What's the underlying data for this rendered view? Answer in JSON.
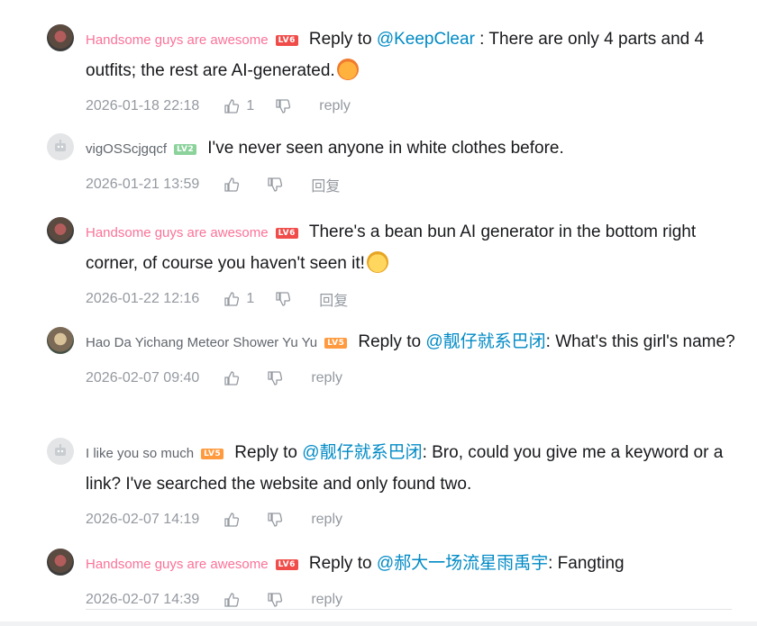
{
  "comments": [
    {
      "user": "Handsome guys are awesome",
      "level": "LV6",
      "reply_prefix": "Reply to",
      "mention": "@KeepClear",
      "text_after": " : There are only 4 parts and 4 outfits; the rest are AI-generated.",
      "time": "2026-01-18 22:18",
      "likes": "1",
      "reply_label": "reply"
    },
    {
      "user": "vigOSScjgqcf",
      "level": "LV2",
      "text": "I've never seen anyone in white clothes before.",
      "time": "2026-01-21 13:59",
      "likes": "",
      "reply_label": "回复"
    },
    {
      "user": "Handsome guys are awesome",
      "level": "LV6",
      "text": "There's a bean bun AI generator in the bottom right corner, of course you haven't seen it!",
      "time": "2026-01-22 12:16",
      "likes": "1",
      "reply_label": "回复"
    },
    {
      "user": "Hao Da Yichang Meteor Shower Yu Yu",
      "level": "LV5",
      "reply_prefix": "Reply to",
      "mention": "@靓仔就系巴闭",
      "text_after": ": What's this girl's name?",
      "time": "2026-02-07 09:40",
      "likes": "",
      "reply_label": "reply"
    },
    {
      "user": "I like you so much",
      "level": "LV5",
      "reply_prefix": "Reply to",
      "mention": "@靓仔就系巴闭",
      "text_after": ": Bro, could you give me a keyword or a link? I've searched the website and only found two.",
      "time": "2026-02-07 14:19",
      "likes": "",
      "reply_label": "reply"
    },
    {
      "user": "Handsome guys are awesome",
      "level": "LV6",
      "reply_prefix": "Reply to",
      "mention": "@郝大一场流星雨禹宇",
      "text_after": ": Fangting",
      "time": "2026-02-07 14:39",
      "likes": "",
      "reply_label": "reply"
    }
  ],
  "icons": {
    "like": "thumbs-up-icon",
    "dislike": "thumbs-down-icon",
    "emoji_blush": "blushing-face-emoji",
    "emoji_cry": "crying-face-emoji"
  },
  "colors": {
    "mention": "#008ac5",
    "vip_name": "#fb7299",
    "meta": "#9499a0"
  }
}
